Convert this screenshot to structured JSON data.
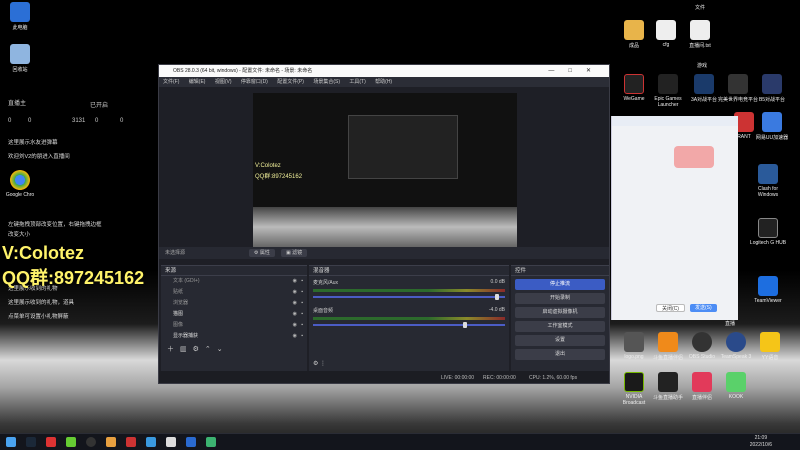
{
  "desktop": {
    "left_icons": [
      "此电脑",
      "回收站",
      "Google Chro"
    ],
    "right_top_icons": [
      "文件",
      "成品",
      "cfg",
      "直播间.txt"
    ],
    "right_group_label": "游戏",
    "right_icons": [
      "WeGame",
      "Epic Games Launcher",
      "3A对战平台",
      "完美世界电竞平台",
      "B5对战平台",
      "RANT",
      "网易UU加速器",
      "Clash for Windows",
      "Logitech G HUB",
      "TeamViewer",
      "logo.png",
      "斗鱼直播伴侣",
      "OBS Studio",
      "TeamSpeak 3",
      "YY语音",
      "NVIDIA Broadcast",
      "斗鱼直播助手",
      "直播伴侣",
      "KOOK"
    ],
    "right_group2_label": "直播",
    "chat_lines": [
      "这里展示水友进弹幕",
      "欢迎刘V2的朋进入直播间",
      "左键拖拽顶部改变位置，右键拖拽边框",
      "改变大小",
      "这里展示收到的礼物",
      "这里展示收到的礼物，道具",
      "点菜单可设置小礼物屏蔽"
    ],
    "ticker": {
      "name": "直播主",
      "status": "已开启",
      "likes": "0",
      "gifts": "0",
      "views": "3131",
      "fans": "0",
      "heart": "0"
    },
    "overlay_name": "V:Colotez",
    "overlay_qq": "QQ群:897245162"
  },
  "obs": {
    "title": "OBS 28.0.3 (64 bit, windows) - 配置文件: 未命名 - 场景: 未命名",
    "menu": [
      "文件(F)",
      "编辑(E)",
      "视图(V)",
      "停靠窗口(D)",
      "配置文件(P)",
      "场景集合(S)",
      "工具(T)",
      "帮助(H)"
    ],
    "preview_watermark_1": "V:Colotez",
    "preview_watermark_2": "QQ群:897245162",
    "scene_bar_label": "未选择源",
    "scene_btn_props": "属性",
    "scene_btn_filters": "滤镜",
    "panels": {
      "sources_title": "来源",
      "mixer_title": "混音器",
      "controls_title": "控件"
    },
    "sources": [
      "文本 (GDI+)",
      "贴纸",
      "浏览器",
      "猫图",
      "图像",
      "显示器捕获"
    ],
    "mixer": [
      {
        "name": "麦克风/Aux",
        "db": "0.0 dB",
        "level": 0.95
      },
      {
        "name": "桌面音频",
        "db": "-4.0 dB",
        "level": 0.78
      }
    ],
    "controls": [
      "停止推流",
      "开始录制",
      "启动虚拟摄像机",
      "工作室模式",
      "设置",
      "退出"
    ],
    "status": {
      "live": "LIVE: 00:00:00",
      "rec": "REC: 00:00:00",
      "cpu": "CPU: 1.2%, 60.00 fps"
    }
  },
  "qq": {
    "cancel": "关闭(C)",
    "send": "发送(S)"
  },
  "clock": {
    "time": "21:09",
    "date": "2022/10/6"
  },
  "colors": {
    "obs_bg": "#1e1f26",
    "accent": "#3b5cc4",
    "overlay_text": "#fff36a",
    "qq_send": "#4c8df5"
  }
}
